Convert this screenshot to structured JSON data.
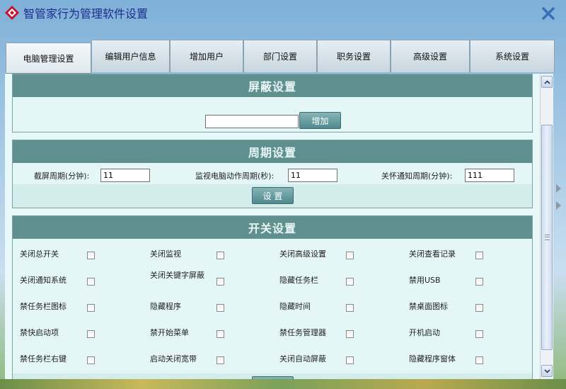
{
  "window": {
    "title": "智管家行为管理软件设置"
  },
  "tabs": [
    {
      "label": "电脑管理设置",
      "active": true
    },
    {
      "label": "编辑用户信息"
    },
    {
      "label": "增加用户"
    },
    {
      "label": "部门设置"
    },
    {
      "label": "职务设置"
    },
    {
      "label": "高级设置"
    },
    {
      "label": "系统设置"
    }
  ],
  "block": {
    "title": "屏蔽设置",
    "input_value": "",
    "add_label": "增加"
  },
  "period": {
    "title": "周期设置",
    "screenshot_label": "截屏周期(分钟):",
    "screenshot_value": "11",
    "monitor_label": "监视电脑动作周期(秒):",
    "monitor_value": "11",
    "care_label": "关怀通知周期(分钟):",
    "care_value": "111",
    "set_label": "设 置"
  },
  "switches": {
    "title": "开关设置",
    "items": [
      "关闭总开关",
      "关闭监视",
      "关闭高级设置",
      "关闭查看记录",
      "关闭通知系统",
      "关闭关键字屏蔽",
      "隐藏任务栏",
      "禁用USB",
      "禁任务栏图标",
      "隐藏程序",
      "隐藏时间",
      "禁桌面图标",
      "禁快启动项",
      "禁开始菜单",
      "禁任务管理器",
      "开机启动",
      "禁任务栏右键",
      "启动关闭宽带",
      "关闭自动屏蔽",
      "隐藏程序窗体"
    ]
  }
}
